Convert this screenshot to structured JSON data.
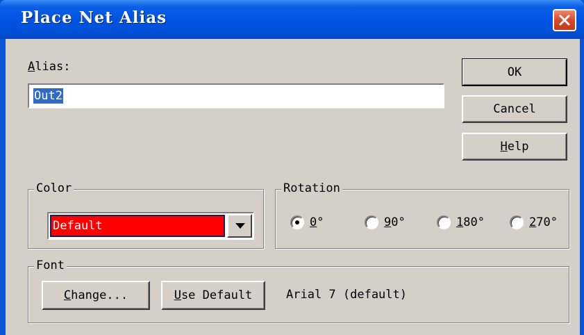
{
  "window": {
    "title": "Place Net Alias"
  },
  "alias": {
    "label_u": "A",
    "label_rest": "lias:",
    "value": "Out2"
  },
  "buttons": {
    "ok": "OK",
    "cancel": "Cancel",
    "help_u": "H",
    "help_rest": "elp",
    "change_u": "C",
    "change_rest": "hange...",
    "use_default_u": "U",
    "use_default_rest": "se Default"
  },
  "color_group": {
    "label": "Color",
    "selected": "Default",
    "selected_color": "#ff0000"
  },
  "rotation_group": {
    "label": "Rotation",
    "options": [
      {
        "u": "0",
        "rest": "°",
        "checked": true
      },
      {
        "u": "9",
        "rest": "0°",
        "checked": false
      },
      {
        "u": "1",
        "rest": "80°",
        "checked": false
      },
      {
        "u": "2",
        "rest": "70°",
        "checked": false
      }
    ]
  },
  "font_group": {
    "label": "Font",
    "description": "Arial 7 (default)"
  },
  "icons": {
    "close": "close-icon",
    "dropdown_arrow": "chevron-down-icon"
  }
}
